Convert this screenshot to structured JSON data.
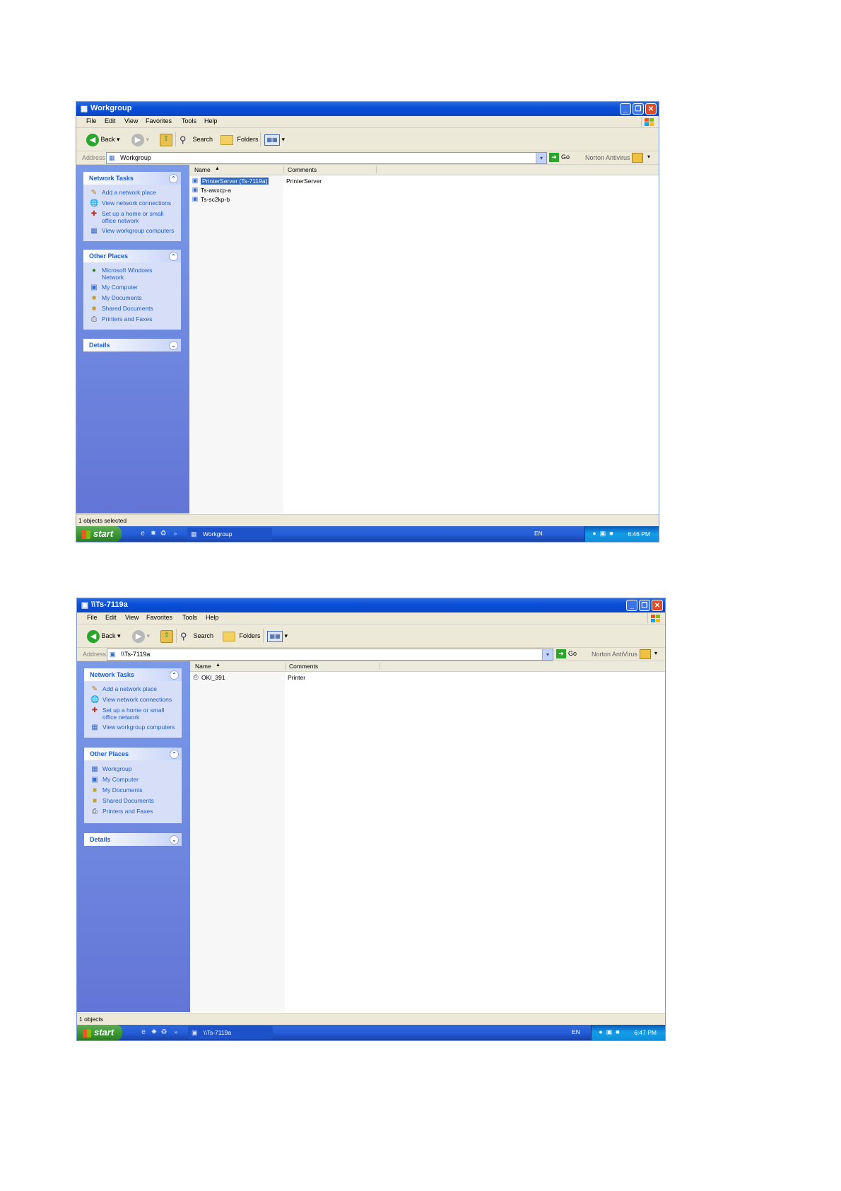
{
  "screenshots": [
    {
      "window_title": "Workgroup",
      "menu": [
        "File",
        "Edit",
        "View",
        "Favorites",
        "Tools",
        "Help"
      ],
      "toolbar": {
        "back": "Back",
        "search": "Search",
        "folders": "Folders"
      },
      "address": {
        "label": "Address",
        "value": "Workgroup",
        "go": "Go",
        "norton": "Norton Antivirus"
      },
      "network_tasks": {
        "title": "Network Tasks",
        "items": [
          "Add a network place",
          "View network connections",
          "Set up a home or small office network",
          "View workgroup computers"
        ]
      },
      "other_places": {
        "title": "Other Places",
        "items": [
          "Microsoft Windows Network",
          "My Computer",
          "My Documents",
          "Shared Documents",
          "Printers and Faxes"
        ]
      },
      "details": {
        "title": "Details"
      },
      "columns": {
        "name": "Name",
        "comments": "Comments"
      },
      "files": [
        {
          "name": "PrinterServer (Ts-7119a)",
          "comment": "PrinterServer",
          "selected": true
        },
        {
          "name": "Ts-awxcp-a",
          "comment": "",
          "selected": false
        },
        {
          "name": "Ts-sc2kp-b",
          "comment": "",
          "selected": false
        }
      ],
      "status": "1 objects selected",
      "taskbar": {
        "start": "start",
        "task": "Workgroup",
        "lang": "EN",
        "clock": "6:46 PM"
      }
    },
    {
      "window_title": "\\\\Ts-7119a",
      "menu": [
        "File",
        "Edit",
        "View",
        "Favorites",
        "Tools",
        "Help"
      ],
      "toolbar": {
        "back": "Back",
        "search": "Search",
        "folders": "Folders"
      },
      "address": {
        "label": "Address",
        "value": "\\\\Ts-7119a",
        "go": "Go",
        "norton": "Norton AntiVirus"
      },
      "network_tasks": {
        "title": "Network Tasks",
        "items": [
          "Add a network place",
          "View network connections",
          "Set up a home or small office network",
          "View workgroup computers"
        ]
      },
      "other_places": {
        "title": "Other Places",
        "items": [
          "Workgroup",
          "My Computer",
          "My Documents",
          "Shared Documents",
          "Printers and Faxes"
        ]
      },
      "details": {
        "title": "Details"
      },
      "columns": {
        "name": "Name",
        "comments": "Comments"
      },
      "files": [
        {
          "name": "OKI_391",
          "comment": "Printer",
          "selected": false
        }
      ],
      "status": "1 objects",
      "taskbar": {
        "start": "start",
        "task": "\\\\Ts-7119a",
        "lang": "EN",
        "clock": "6:47 PM"
      }
    }
  ]
}
